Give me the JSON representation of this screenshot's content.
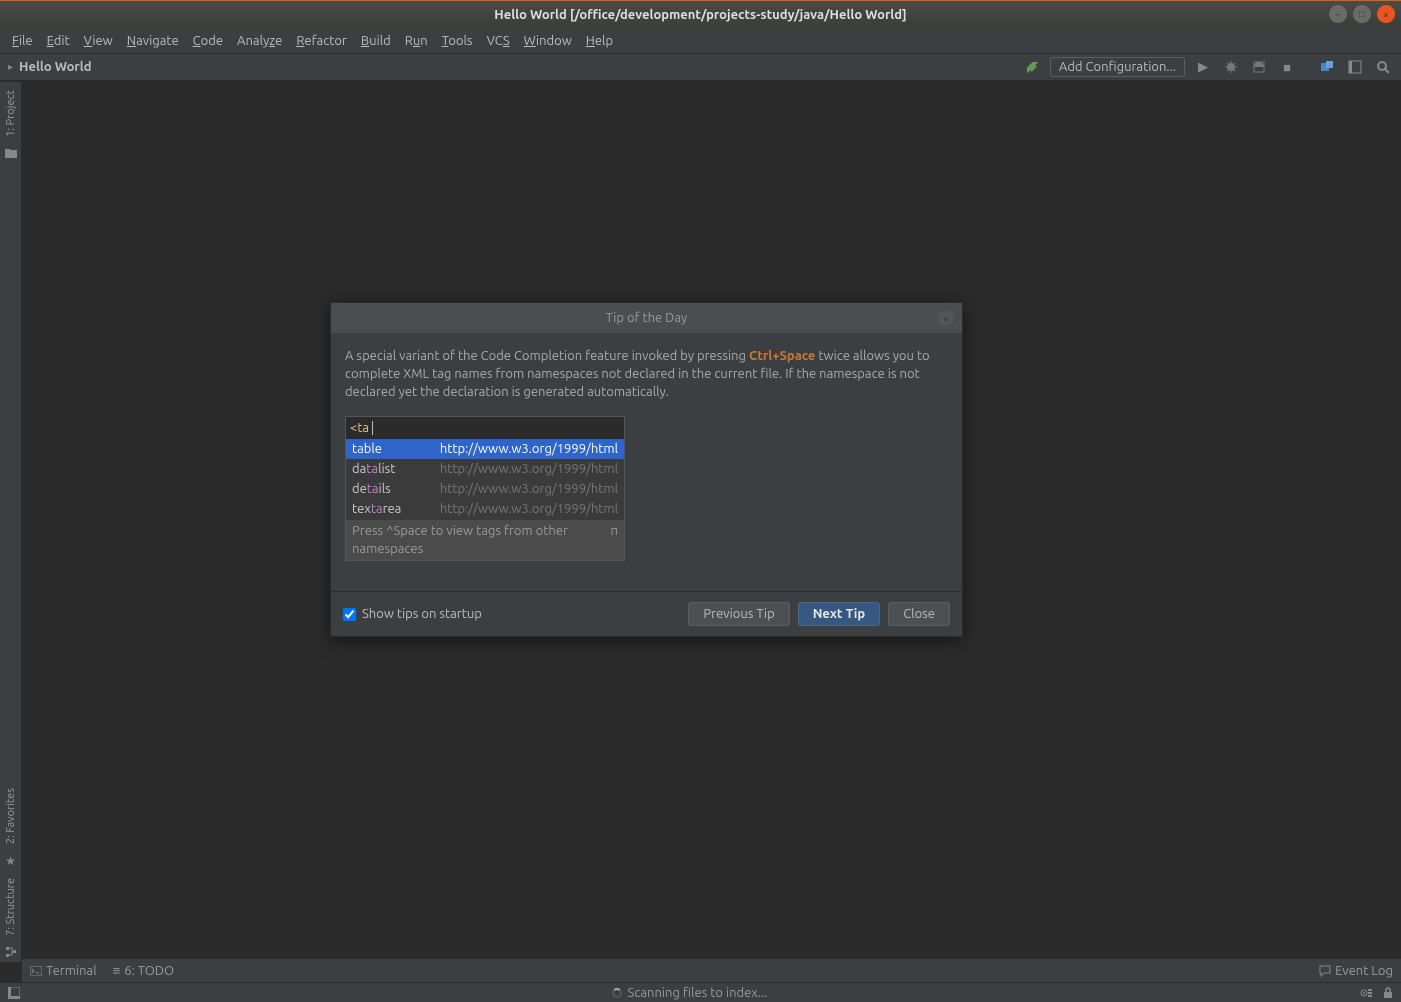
{
  "titlebar": {
    "title": "Hello World [/office/development/projects-study/java/Hello World]"
  },
  "menubar": {
    "items": [
      "File",
      "Edit",
      "View",
      "Navigate",
      "Code",
      "Analyze",
      "Refactor",
      "Build",
      "Run",
      "Tools",
      "VCS",
      "Window",
      "Help"
    ]
  },
  "navbar": {
    "breadcrumb_sep": "▸",
    "breadcrumb_item": "Hello World",
    "add_config": "Add Configuration..."
  },
  "sidebar": {
    "top": [
      {
        "label": "1: Project"
      }
    ],
    "bottom": [
      {
        "label": "2: Favorites"
      },
      {
        "label": "7: Structure"
      }
    ]
  },
  "dialog": {
    "title": "Tip of the Day",
    "tip_prefix": "A special variant of the Code Completion feature invoked by pressing ",
    "tip_shortcut": "Ctrl+Space",
    "tip_suffix": " twice allows you to complete XML tag names from namespaces not declared in the current file. If the namespace is not declared yet the declaration is generated automatically.",
    "code_input_prefix": "<",
    "code_input_text": "ta",
    "completions": [
      {
        "pre": "t",
        "match": "a",
        "post": "ble",
        "ns": "http://www.w3.org/1999/html",
        "selected": true
      },
      {
        "pre": "da",
        "match": "ta",
        "post": "list",
        "ns": "http://www.w3.org/1999/html",
        "selected": false
      },
      {
        "pre": "de",
        "match": "ta",
        "post": "ils",
        "ns": "http://www.w3.org/1999/html",
        "selected": false
      },
      {
        "pre": "tex",
        "match": "ta",
        "post": "rea",
        "ns": "http://www.w3.org/1999/html",
        "selected": false
      }
    ],
    "hint": "Press ^Space to view tags from other namespaces",
    "hint_icon": "π",
    "show_tips_label": "Show tips on startup",
    "show_tips_checked": true,
    "prev_btn": "Previous Tip",
    "next_btn": "Next Tip",
    "close_btn": "Close"
  },
  "toolwindows": {
    "terminal": "Terminal",
    "todo": "6: TODO",
    "eventlog": "Event Log"
  },
  "statusbar": {
    "scanning": "Scanning files to index..."
  }
}
